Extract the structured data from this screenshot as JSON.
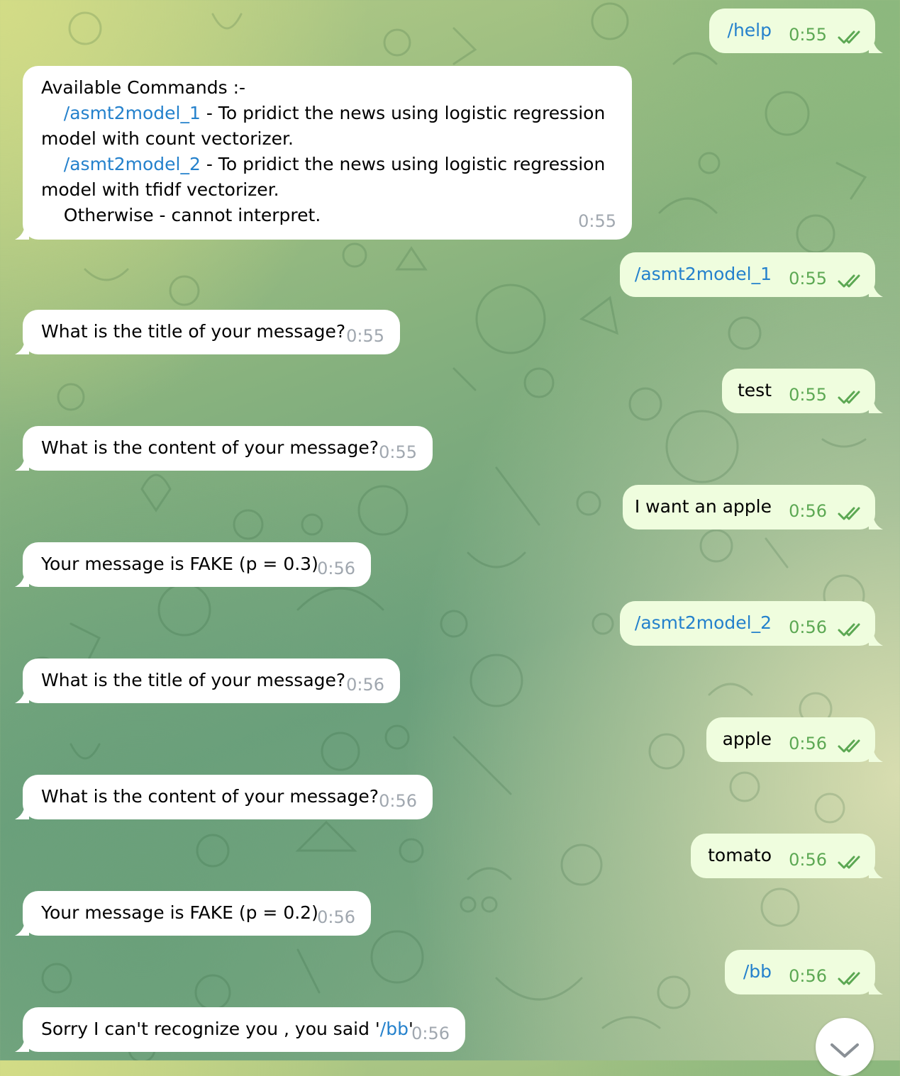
{
  "messages": [
    {
      "dir": "out",
      "text": "/help",
      "cmd": true,
      "time": "0:55"
    },
    {
      "dir": "in",
      "lines": [
        {
          "parts": [
            {
              "t": "Available Commands :-"
            }
          ]
        },
        {
          "parts": [
            {
              "t": "    "
            },
            {
              "t": "/asmt2model_1",
              "cmd": true
            },
            {
              "t": " - To pridict the news using logistic regression"
            }
          ]
        },
        {
          "parts": [
            {
              "t": "model with count vectorizer."
            }
          ]
        },
        {
          "parts": [
            {
              "t": "    "
            },
            {
              "t": "/asmt2model_2",
              "cmd": true
            },
            {
              "t": " - To pridict the news using logistic regression"
            }
          ]
        },
        {
          "parts": [
            {
              "t": "model with tfidf vectorizer."
            }
          ]
        },
        {
          "parts": [
            {
              "t": "    Otherwise - cannot interpret."
            }
          ]
        }
      ],
      "time": "0:55"
    },
    {
      "dir": "out",
      "text": "/asmt2model_1",
      "cmd": true,
      "time": "0:55"
    },
    {
      "dir": "in",
      "text": "What is the title of your message?",
      "time": "0:55"
    },
    {
      "dir": "out",
      "text": "test",
      "time": "0:55"
    },
    {
      "dir": "in",
      "text": "What is the content of your message?",
      "time": "0:55"
    },
    {
      "dir": "out",
      "text": "I want an apple",
      "time": "0:56"
    },
    {
      "dir": "in",
      "text": "Your message is FAKE (p = 0.3)",
      "time": "0:56"
    },
    {
      "dir": "out",
      "text": "/asmt2model_2",
      "cmd": true,
      "time": "0:56"
    },
    {
      "dir": "in",
      "text": "What is the title of your message?",
      "time": "0:56"
    },
    {
      "dir": "out",
      "text": "apple",
      "time": "0:56"
    },
    {
      "dir": "in",
      "text": "What is the content of your message?",
      "time": "0:56"
    },
    {
      "dir": "out",
      "text": "tomato",
      "time": "0:56"
    },
    {
      "dir": "in",
      "text": "Your message is FAKE (p = 0.2)",
      "time": "0:56"
    },
    {
      "dir": "out",
      "text": "/bb",
      "cmd": true,
      "time": "0:56"
    },
    {
      "dir": "in",
      "parts": [
        {
          "t": "Sorry I can't recognize you , you said '"
        },
        {
          "t": "/bb",
          "cmd": true
        },
        {
          "t": "'"
        }
      ],
      "time": "0:56"
    }
  ],
  "icons": {
    "read_status": "double-check-icon",
    "scroll_down": "chevron-down-icon"
  },
  "colors": {
    "incoming_bubble": "#ffffff",
    "outgoing_bubble": "#effdde",
    "link": "#2481cc",
    "outgoing_time": "#5ca853",
    "incoming_time": "#a0a7af"
  }
}
